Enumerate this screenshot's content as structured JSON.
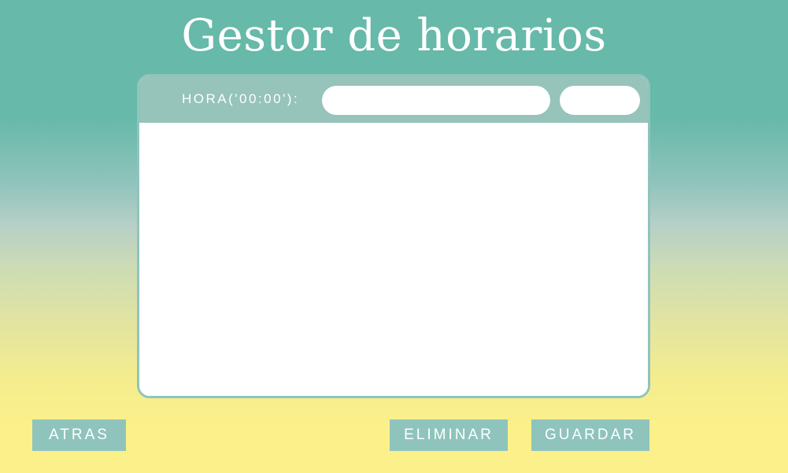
{
  "window": {
    "title": "Gestor de horarios"
  },
  "form": {
    "hora_label": "HORA('00:00'):",
    "hora_value": "",
    "hora_placeholder": ""
  },
  "footer": {
    "atras_label": "ATRAS",
    "eliminar_label": "ELIMINAR",
    "guardar_label": "GUARDAR"
  },
  "colors": {
    "teal_top": "#67b9a9",
    "yellow_bottom": "#fbf08a",
    "accent": "#8fc4bd",
    "panel_header": "#96c3ba",
    "text_on_accent": "#ffffff"
  }
}
